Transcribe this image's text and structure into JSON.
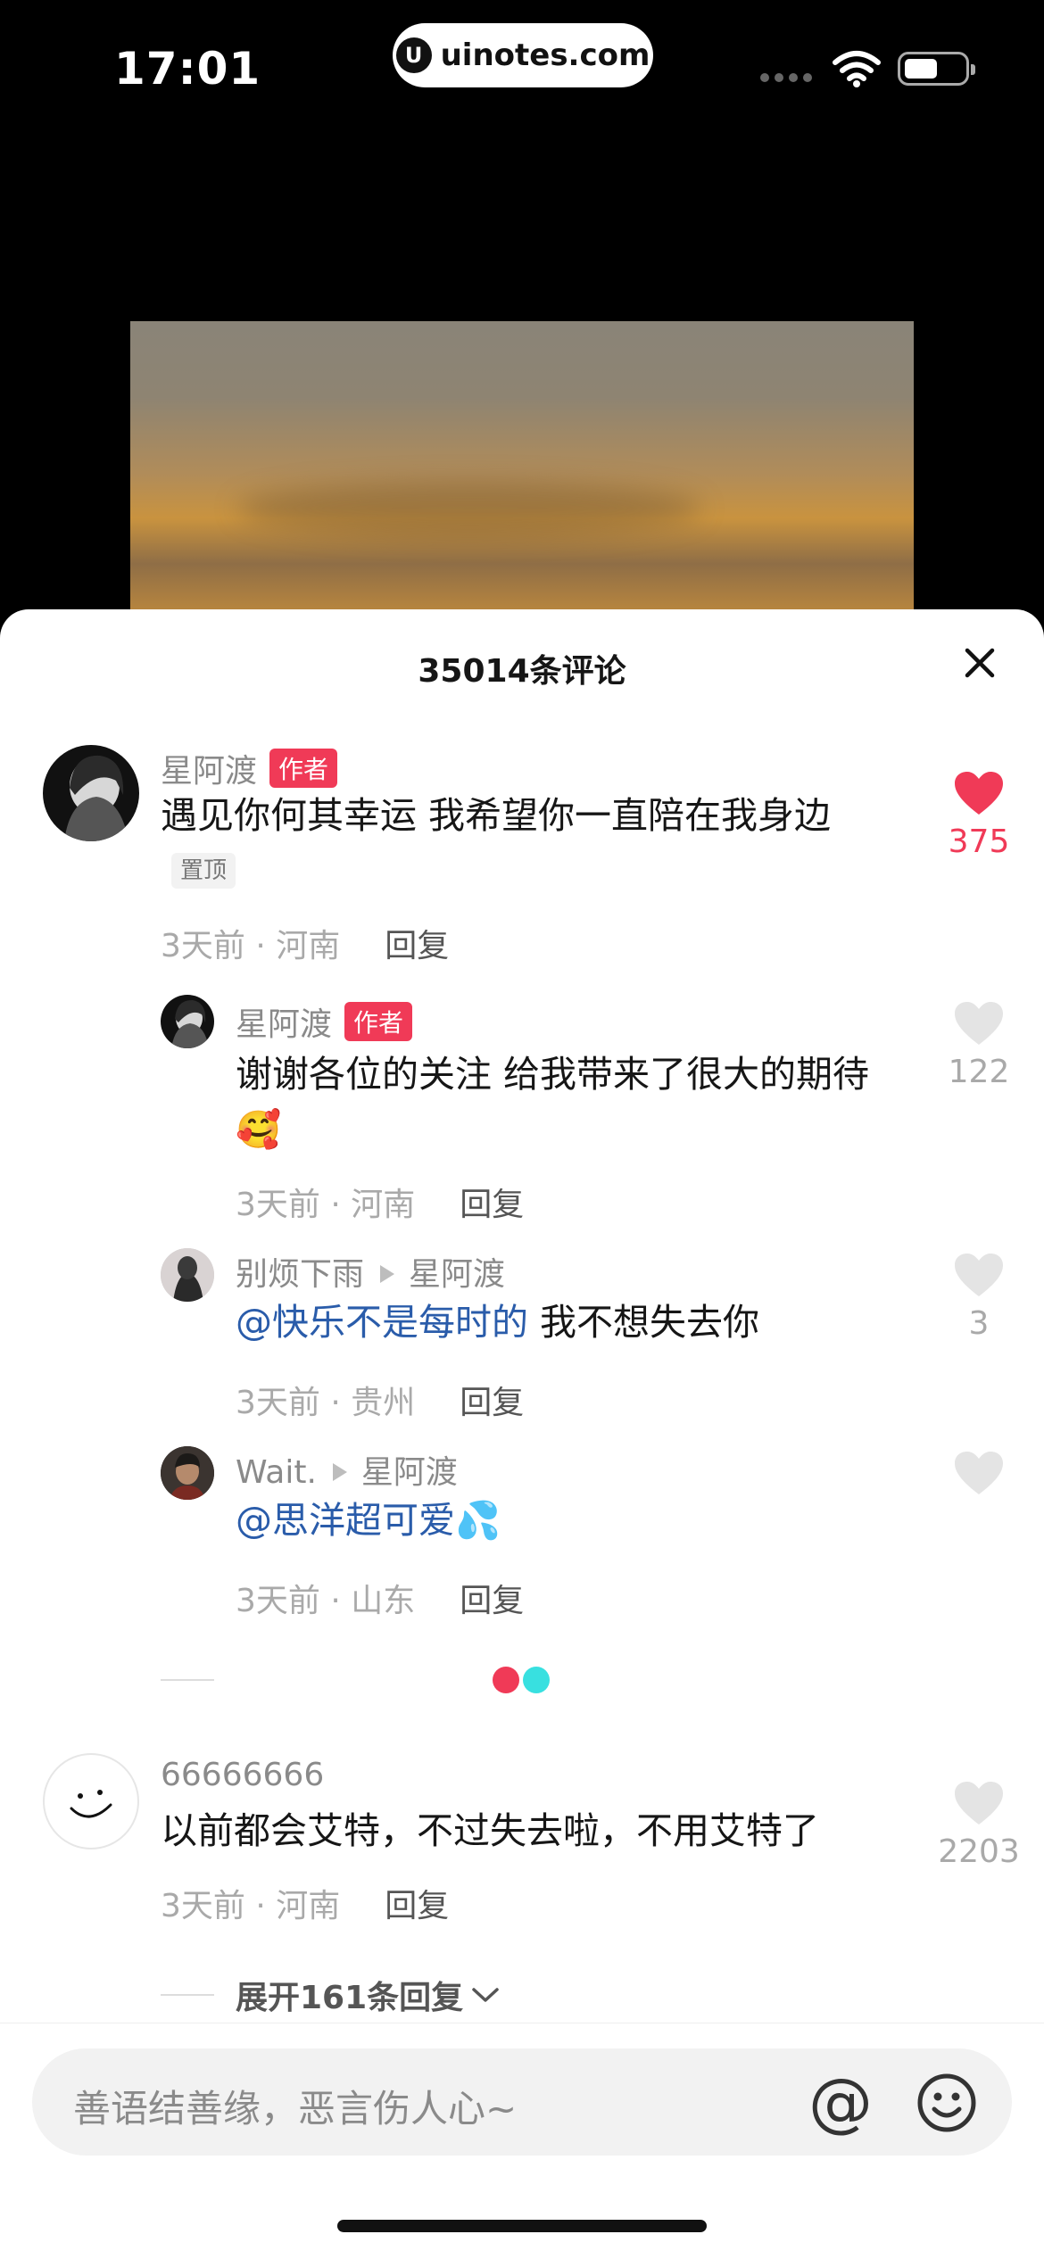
{
  "status_bar": {
    "time": "17:01",
    "url": "uinotes.com",
    "logo_letter": "U"
  },
  "sheet": {
    "title": "35014条评论"
  },
  "comments": [
    {
      "user": "星阿渡",
      "tag": "作者",
      "text": "遇见你何其幸运 我希望你一直陪在我身边",
      "pin": "置顶",
      "time_place": "3天前 · 河南",
      "reply": "回复",
      "likes": "375",
      "liked": true
    },
    {
      "user": "星阿渡",
      "tag": "作者",
      "text": "谢谢各位的关注 给我带来了很大的期待🥰",
      "time_place": "3天前 · 河南",
      "reply": "回复",
      "likes": "122"
    },
    {
      "user": "别烦下雨",
      "reply_to": "星阿渡",
      "mention": "@快乐不是每时的",
      "text": " 我不想失去你",
      "time_place": "3天前 · 贵州",
      "reply": "回复",
      "likes": "3"
    },
    {
      "user": "Wait.",
      "reply_to": "星阿渡",
      "mention": "@思洋超可爱💦",
      "time_place": "3天前 · 山东",
      "reply": "回复",
      "likes": ""
    },
    {
      "user": "66666666",
      "text": "以前都会艾特，不过失去啦，不用艾特了",
      "time_place": "3天前 · 河南",
      "reply": "回复",
      "likes": "2203"
    }
  ],
  "expand": {
    "label": "展开161条回复"
  },
  "input": {
    "placeholder": "善语结善缘，恶言伤人心~",
    "at_symbol": "@"
  },
  "colors": {
    "accent": "#f03a57",
    "mention": "#2a5caa"
  }
}
